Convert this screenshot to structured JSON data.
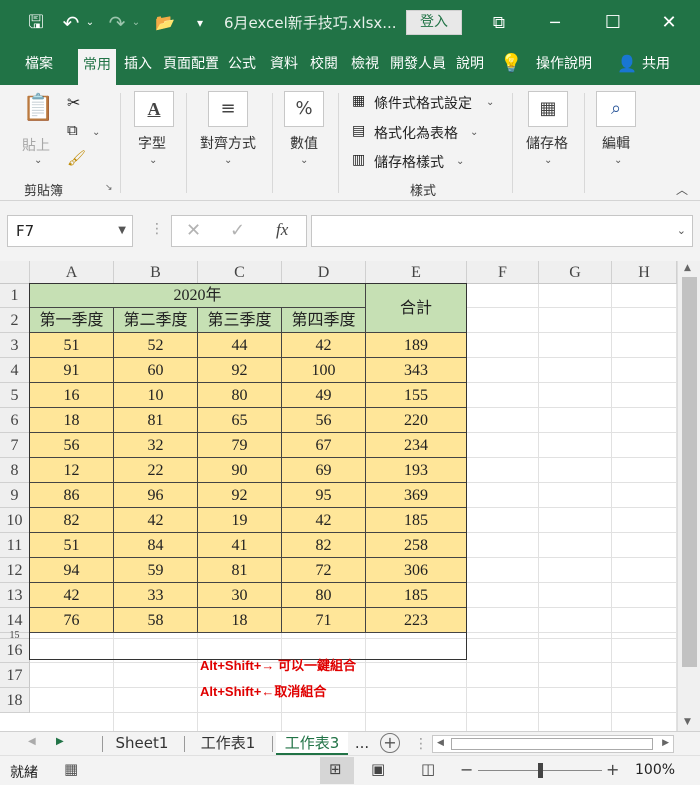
{
  "titlebar": {
    "doc_title": "6月excel新手技巧.xlsx...",
    "login_label": "登入",
    "minimize_glyph": "─",
    "maximize_glyph": "☐",
    "close_glyph": "✕",
    "save_glyph": "🖫",
    "undo_glyph": "↶",
    "redo_glyph": "↷",
    "open_glyph": "📂",
    "customize_glyph": "▾",
    "restore_glyph": "⧉"
  },
  "ribbon_tabs": [
    "檔案",
    "常用",
    "插入",
    "頁面配置",
    "公式",
    "資料",
    "校閱",
    "檢視",
    "開發人員",
    "說明",
    "操作說明",
    "共用"
  ],
  "ribbon": {
    "clipboard": {
      "paste": "貼上",
      "group_label": "剪貼簿"
    },
    "font": {
      "label": "字型"
    },
    "alignment": {
      "label": "對齊方式"
    },
    "number": {
      "label": "數值"
    },
    "styles": {
      "conditional": "條件式格式設定",
      "table": "格式化為表格",
      "cell_styles": "儲存格樣式",
      "group_label": "樣式"
    },
    "cells": {
      "label": "儲存格"
    },
    "editing": {
      "label": "編輯"
    }
  },
  "formula_bar": {
    "name_box": "F7",
    "fx": "fx",
    "cancel": "✕",
    "enter": "✓",
    "value": ""
  },
  "grid": {
    "columns": [
      "A",
      "B",
      "C",
      "D",
      "E",
      "F",
      "G",
      "H"
    ],
    "rows": [
      "1",
      "2",
      "3",
      "4",
      "5",
      "6",
      "7",
      "8",
      "9",
      "10",
      "11",
      "12",
      "13",
      "14",
      "15",
      "16",
      "17",
      "18"
    ],
    "header_year": "2020年",
    "total_header": "合計",
    "quarters": [
      "第一季度",
      "第二季度",
      "第三季度",
      "第四季度"
    ],
    "data": [
      [
        "51",
        "52",
        "44",
        "42",
        "189"
      ],
      [
        "91",
        "60",
        "92",
        "100",
        "343"
      ],
      [
        "16",
        "10",
        "80",
        "49",
        "155"
      ],
      [
        "18",
        "81",
        "65",
        "56",
        "220"
      ],
      [
        "56",
        "32",
        "79",
        "67",
        "234"
      ],
      [
        "12",
        "22",
        "90",
        "69",
        "193"
      ],
      [
        "86",
        "96",
        "92",
        "95",
        "369"
      ],
      [
        "82",
        "42",
        "19",
        "42",
        "185"
      ],
      [
        "51",
        "84",
        "41",
        "82",
        "258"
      ],
      [
        "94",
        "59",
        "81",
        "72",
        "306"
      ],
      [
        "42",
        "33",
        "30",
        "80",
        "185"
      ],
      [
        "76",
        "58",
        "18",
        "71",
        "223"
      ]
    ],
    "note1": "Alt+Shift+→ 可以一鍵組合",
    "note2": "Alt+Shift+←取消組合"
  },
  "sheet_tabs": [
    "Sheet1",
    "工作表1",
    "工作表3"
  ],
  "sheet_more": "...",
  "statusbar": {
    "ready": "就緒",
    "zoom": "100%",
    "zoom_level": 1.0
  },
  "colors": {
    "excel_green": "#217346",
    "data_fill": "#ffe699",
    "header_fill": "#c6e0b4",
    "note_red": "#e00000"
  }
}
